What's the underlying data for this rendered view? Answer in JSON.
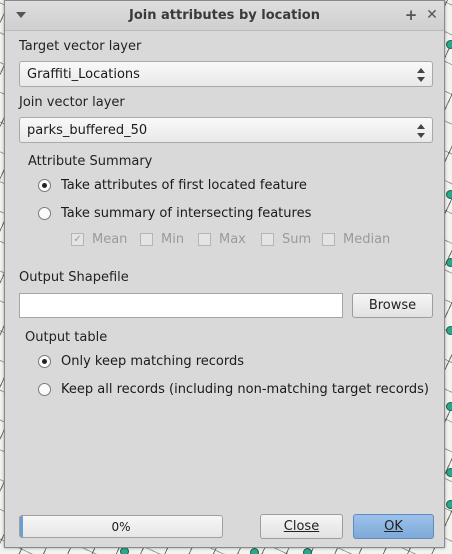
{
  "window": {
    "title": "Join attributes by location"
  },
  "target_layer": {
    "label": "Target vector layer",
    "selected": "Graffiti_Locations"
  },
  "join_layer": {
    "label": "Join vector layer",
    "selected": "parks_buffered_50"
  },
  "attribute_summary": {
    "title": "Attribute Summary",
    "options": [
      {
        "label": "Take attributes of first located feature",
        "checked": true
      },
      {
        "label": "Take summary of intersecting features",
        "checked": false
      }
    ],
    "stats": [
      {
        "label": "Mean",
        "checked": true
      },
      {
        "label": "Min",
        "checked": false
      },
      {
        "label": "Max",
        "checked": false
      },
      {
        "label": "Sum",
        "checked": false
      },
      {
        "label": "Median",
        "checked": false
      }
    ]
  },
  "output": {
    "label": "Output Shapefile",
    "value": "",
    "browse_label": "Browse"
  },
  "output_table": {
    "title": "Output table",
    "options": [
      {
        "label": "Only keep matching records",
        "checked": true
      },
      {
        "label": "Keep all records (including non-matching target records)",
        "checked": false
      }
    ]
  },
  "footer": {
    "progress_text": "0%",
    "progress_fraction": 0.0,
    "close_label": "Close",
    "ok_label": "OK"
  },
  "colors": {
    "dialog_bg": "#d9d9d9",
    "ok_button": "#8fb6e2",
    "progress_fill": "#6e9dd2",
    "map_point": "#2aa88a"
  }
}
